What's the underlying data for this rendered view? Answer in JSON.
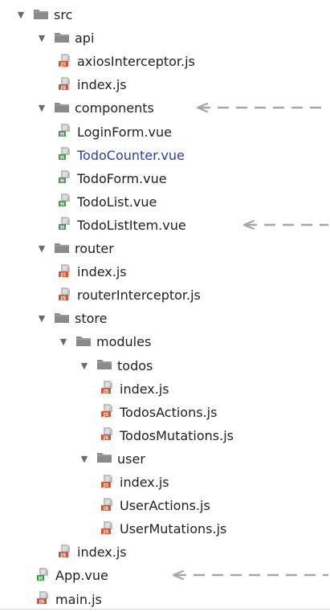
{
  "tree": [
    {
      "label": "src",
      "kind": "folder",
      "depth": 0,
      "expanded": true
    },
    {
      "label": "api",
      "kind": "folder",
      "depth": 1,
      "expanded": true
    },
    {
      "label": "axiosInterceptor.js",
      "kind": "js",
      "depth": 2
    },
    {
      "label": "index.js",
      "kind": "js",
      "depth": 2
    },
    {
      "label": "components",
      "kind": "folder",
      "depth": 1,
      "expanded": true,
      "arrow": true
    },
    {
      "label": "LoginForm.vue",
      "kind": "vue",
      "depth": 2
    },
    {
      "label": "TodoCounter.vue",
      "kind": "vue",
      "depth": 2,
      "selected": true
    },
    {
      "label": "TodoForm.vue",
      "kind": "vue",
      "depth": 2
    },
    {
      "label": "TodoList.vue",
      "kind": "vue",
      "depth": 2
    },
    {
      "label": "TodoListItem.vue",
      "kind": "vue",
      "depth": 2,
      "arrow": true
    },
    {
      "label": "router",
      "kind": "folder",
      "depth": 1,
      "expanded": true
    },
    {
      "label": "index.js",
      "kind": "js",
      "depth": 2
    },
    {
      "label": "routerInterceptor.js",
      "kind": "js",
      "depth": 2
    },
    {
      "label": "store",
      "kind": "folder",
      "depth": 1,
      "expanded": true
    },
    {
      "label": "modules",
      "kind": "folder",
      "depth": 2,
      "expanded": true
    },
    {
      "label": "todos",
      "kind": "folder",
      "depth": 3,
      "expanded": true
    },
    {
      "label": "index.js",
      "kind": "js",
      "depth": 4
    },
    {
      "label": "TodosActions.js",
      "kind": "js",
      "depth": 4
    },
    {
      "label": "TodosMutations.js",
      "kind": "js",
      "depth": 4
    },
    {
      "label": "user",
      "kind": "folder",
      "depth": 3,
      "expanded": true
    },
    {
      "label": "index.js",
      "kind": "js",
      "depth": 4
    },
    {
      "label": "UserActions.js",
      "kind": "js",
      "depth": 4
    },
    {
      "label": "UserMutations.js",
      "kind": "js",
      "depth": 4
    },
    {
      "label": "index.js",
      "kind": "js",
      "depth": 2
    },
    {
      "label": "App.vue",
      "kind": "vue",
      "depth": 1,
      "arrow": true
    },
    {
      "label": "main.js",
      "kind": "js",
      "depth": 1
    }
  ],
  "colors": {
    "folder": "#8a8a8a",
    "js_badge": "#d9532c",
    "vue_badge": "#3f9f4a",
    "doc": "#bdbdbd",
    "arrow": "#a6a6a6",
    "selected_text": "#2a3f9e"
  },
  "icons": {
    "expand": "triangle-down-icon",
    "folder": "folder-icon",
    "js": "js-file-icon",
    "vue": "vue-file-icon",
    "pointer": "dashed-arrow-icon"
  }
}
